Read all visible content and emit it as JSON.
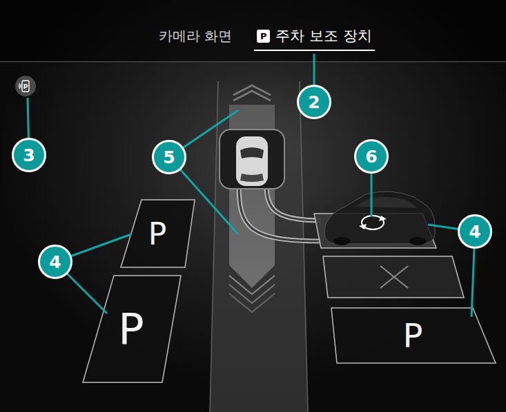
{
  "tabs": [
    {
      "label": "카메라 화면",
      "selected": false
    },
    {
      "label": "주차 보조 장치",
      "selected": true,
      "badge": "P"
    }
  ],
  "remote_parking_button": {
    "glyph": "P"
  },
  "parking_spots": [
    {
      "kind": "free",
      "label": "P"
    },
    {
      "kind": "free",
      "label": "P"
    },
    {
      "kind": "occupied"
    },
    {
      "kind": "blocked"
    },
    {
      "kind": "free",
      "label": "P"
    }
  ],
  "callouts": [
    {
      "number": "2"
    },
    {
      "number": "3"
    },
    {
      "number": "4"
    },
    {
      "number": "4"
    },
    {
      "number": "5"
    },
    {
      "number": "6"
    }
  ]
}
